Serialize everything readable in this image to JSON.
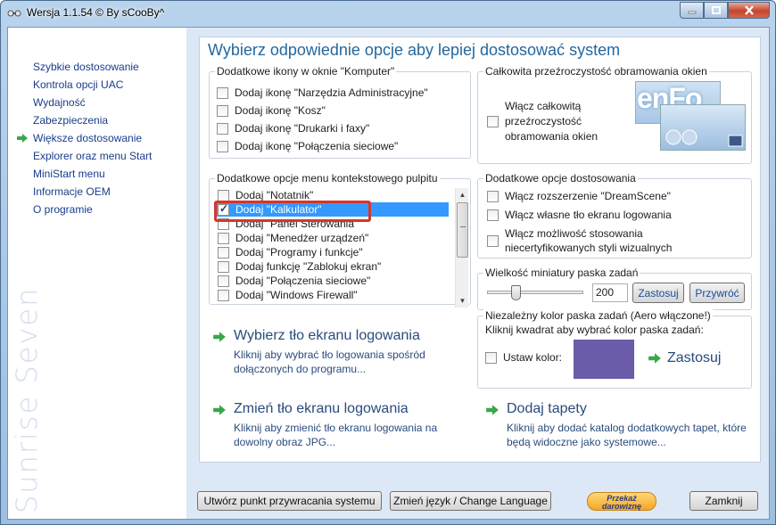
{
  "window": {
    "title": "Wersja 1.1.54 © By sCooBy^",
    "controls": [
      "minimize-icon",
      "maximize-icon",
      "close-icon"
    ]
  },
  "sidebar": {
    "items": [
      {
        "label": "Szybkie dostosowanie",
        "active": false
      },
      {
        "label": "Kontrola opcji UAC",
        "active": false
      },
      {
        "label": "Wydajność",
        "active": false
      },
      {
        "label": "Zabezpieczenia",
        "active": false
      },
      {
        "label": "Większe dostosowanie",
        "active": true
      },
      {
        "label": "Explorer oraz menu Start",
        "active": false
      },
      {
        "label": "MiniStart menu",
        "active": false
      },
      {
        "label": "Informacje OEM",
        "active": false
      },
      {
        "label": "O programie",
        "active": false
      }
    ],
    "brand": "Sunrise Seven"
  },
  "main": {
    "heading": "Wybierz odpowiednie opcje aby lepiej dostosować system",
    "computer_icons": {
      "title": "Dodatkowe ikony w oknie \"Komputer\"",
      "items": [
        {
          "label": "Dodaj ikonę \"Narzędzia Administracyjne\"",
          "checked": false
        },
        {
          "label": "Dodaj ikonę \"Kosz\"",
          "checked": false
        },
        {
          "label": "Dodaj ikonę \"Drukarki i faxy\"",
          "checked": false
        },
        {
          "label": "Dodaj ikonę \"Połączenia sieciowe\"",
          "checked": false
        }
      ]
    },
    "transparency": {
      "title": "Całkowita przeźroczystość obramowania okien",
      "label": "Włącz całkowitą przeźroczystość obramowania okien",
      "line1": "Włącz całkowitą",
      "line2": "przeźroczystość",
      "line3": "obramowania okien",
      "checked": false,
      "preview_text": "enFo"
    },
    "context_menu": {
      "title": "Dodatkowe opcje menu kontekstowego pulpitu",
      "items": [
        {
          "label": "Dodaj \"Notatnik\"",
          "checked": false,
          "selected": false
        },
        {
          "label": "Dodaj \"Kalkulator\"",
          "checked": true,
          "selected": true
        },
        {
          "label": "Dodaj \"Panel Sterowania\"",
          "checked": false,
          "selected": false
        },
        {
          "label": "Dodaj \"Menedżer urządzeń\"",
          "checked": false,
          "selected": false
        },
        {
          "label": "Dodaj \"Programy i funkcje\"",
          "checked": false,
          "selected": false
        },
        {
          "label": "Dodaj funkcję \"Zablokuj ekran\"",
          "checked": false,
          "selected": false
        },
        {
          "label": "Dodaj \"Połączenia sieciowe\"",
          "checked": false,
          "selected": false
        },
        {
          "label": "Dodaj \"Windows Firewall\"",
          "checked": false,
          "selected": false
        }
      ]
    },
    "custom_options": {
      "title": "Dodatkowe opcje dostosowania",
      "items": [
        {
          "label": "Włącz rozszerzenie \"DreamScene\"",
          "checked": false
        },
        {
          "label": "Włącz własne tło ekranu logowania",
          "checked": false
        },
        {
          "label": "Włącz możliwość stosowania niecertyfikowanych styli wizualnych",
          "line1": "Włącz możliwość stosowania",
          "line2": "niecertyfikowanych styli wizualnych",
          "checked": false
        }
      ]
    },
    "taskbar_thumb": {
      "title": "Wielkość miniatury paska zadań",
      "value": "200",
      "slider_fraction": 0.3,
      "apply_label": "Zastosuj",
      "restore_label": "Przywróć"
    },
    "taskbar_color": {
      "title": "Niezależny kolor paska zadań (Aero włączone!)",
      "hint": "Kliknij kwadrat aby wybrać kolor paska zadań:",
      "set_label": "Ustaw kolor:",
      "checked": false,
      "color": "#6c5ba8",
      "apply_label": "Zastosuj"
    },
    "tasks": [
      {
        "title": "Wybierz tło ekranu logowania",
        "desc1": "Kliknij aby wybrać tło logowania spośród",
        "desc2": "dołączonych do programu..."
      },
      {
        "title": "Zmień tło ekranu logowania",
        "desc1": "Kliknij aby zmienić tło ekranu logowania na",
        "desc2": "dowolny obraz JPG..."
      },
      {
        "title": "Dodaj tapety",
        "desc1": "Kliknij aby dodać katalog dodatkowych tapet, które",
        "desc2": "będą widoczne jako systemowe..."
      }
    ]
  },
  "footer": {
    "restore_point": "Utwórz punkt przywracania systemu",
    "language": "Zmień język / Change Language",
    "donate_line1": "Przekaż",
    "donate_line2": "darowiznę",
    "close": "Zamknij"
  },
  "colors": {
    "accent": "#25679c",
    "selection": "#3399ff",
    "highlight": "#d8352a",
    "green_arrow": "#3aa64a"
  }
}
